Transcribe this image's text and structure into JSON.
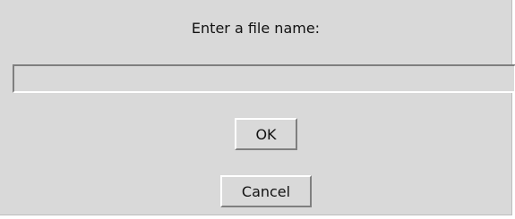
{
  "dialog": {
    "prompt": "Enter a file name:",
    "filename_value": "",
    "ok_label": "OK",
    "cancel_label": "Cancel"
  }
}
